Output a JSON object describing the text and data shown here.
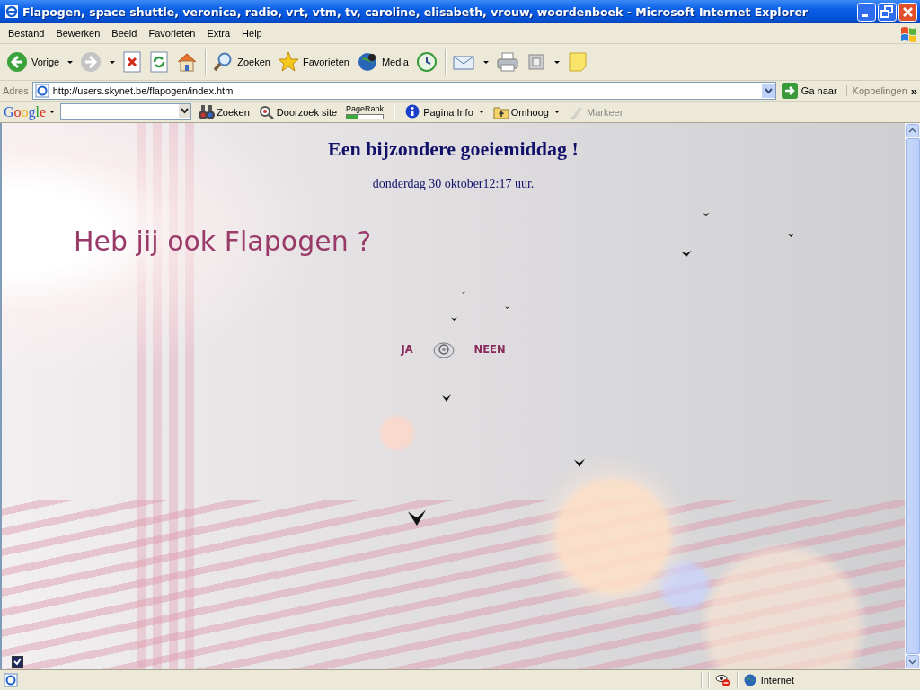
{
  "window": {
    "title": "Flapogen, space shuttle, veronica, radio, vrt, vtm, tv, caroline, elisabeth, vrouw, woordenboek - Microsoft Internet Explorer"
  },
  "menu_bar": [
    "Bestand",
    "Bewerken",
    "Beeld",
    "Favorieten",
    "Extra",
    "Help"
  ],
  "toolbar": {
    "back": "Vorige",
    "search": "Zoeken",
    "favorites": "Favorieten",
    "media": "Media"
  },
  "address_bar": {
    "label": "Adres",
    "url": "http://users.skynet.be/flapogen/index.htm",
    "go": "Ga naar",
    "links": "Koppelingen",
    "more": "»"
  },
  "google_toolbar": {
    "logo": "Google",
    "items": [
      {
        "label": "Zoeken",
        "disabled": false
      },
      {
        "label": "Doorzoek site",
        "disabled": false
      },
      {
        "label": "PageRank",
        "disabled": false
      },
      {
        "label": "Pagina Info",
        "disabled": false
      },
      {
        "label": "Omhoog",
        "disabled": false
      },
      {
        "label": "Markeer",
        "disabled": true
      }
    ]
  },
  "page": {
    "heading": "Een bijzondere goeiemiddag !",
    "date": "donderdag 30 oktober12:17 uur.",
    "question": "Heb jij ook Flapogen ?",
    "answers": [
      "JA",
      "NEEN"
    ],
    "checkbox": {
      "checked": true
    }
  },
  "status_bar": {
    "zone": "Internet"
  }
}
